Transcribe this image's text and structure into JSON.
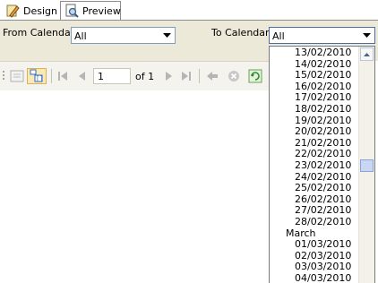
{
  "tabs": [
    {
      "label": "Design",
      "icon": "design-icon"
    },
    {
      "label": "Preview",
      "icon": "preview-icon"
    }
  ],
  "params": {
    "from_label": "From Calendar",
    "from_value": "All",
    "to_label": "To Calendar",
    "to_value": "All"
  },
  "toolbar": {
    "page_value": "1",
    "of_label": "of 1"
  },
  "dropdown_items": [
    {
      "text": "13/02/2010",
      "kind": "date"
    },
    {
      "text": "14/02/2010",
      "kind": "date"
    },
    {
      "text": "15/02/2010",
      "kind": "date"
    },
    {
      "text": "16/02/2010",
      "kind": "date"
    },
    {
      "text": "17/02/2010",
      "kind": "date"
    },
    {
      "text": "18/02/2010",
      "kind": "date"
    },
    {
      "text": "19/02/2010",
      "kind": "date"
    },
    {
      "text": "20/02/2010",
      "kind": "date"
    },
    {
      "text": "21/02/2010",
      "kind": "date"
    },
    {
      "text": "22/02/2010",
      "kind": "date"
    },
    {
      "text": "23/02/2010",
      "kind": "date"
    },
    {
      "text": "24/02/2010",
      "kind": "date"
    },
    {
      "text": "25/02/2010",
      "kind": "date"
    },
    {
      "text": "26/02/2010",
      "kind": "date"
    },
    {
      "text": "27/02/2010",
      "kind": "date"
    },
    {
      "text": "28/02/2010",
      "kind": "date"
    },
    {
      "text": "March",
      "kind": "month"
    },
    {
      "text": "01/03/2010",
      "kind": "date"
    },
    {
      "text": "02/03/2010",
      "kind": "date"
    },
    {
      "text": "03/03/2010",
      "kind": "date"
    },
    {
      "text": "04/03/2010",
      "kind": "date"
    }
  ]
}
